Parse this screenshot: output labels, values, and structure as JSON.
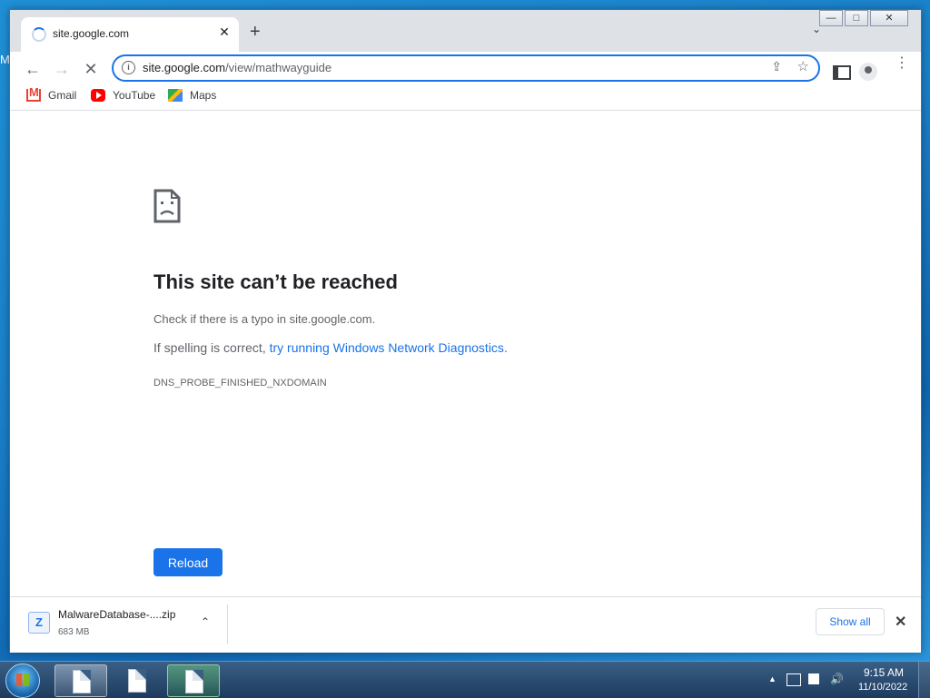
{
  "desktop": {
    "edge_char": "M"
  },
  "browser": {
    "tab": {
      "title": "site.google.com",
      "close_glyph": "✕"
    },
    "new_tab_glyph": "+",
    "tab_search_glyph": "⌄",
    "caption": {
      "minimize": "—",
      "maximize": "□",
      "close": "✕"
    },
    "nav": {
      "back": "←",
      "forward": "→",
      "stop": "✕"
    },
    "omnibox": {
      "host": "site.google.com",
      "path": "/view/mathwayguide",
      "info_glyph": "i",
      "share_glyph": "⇪",
      "star_glyph": "☆"
    },
    "menu_glyph": "⋮",
    "bookmarks": [
      {
        "label": "Gmail",
        "icon": "gmail-icon"
      },
      {
        "label": "YouTube",
        "icon": "youtube-icon"
      },
      {
        "label": "Maps",
        "icon": "maps-icon"
      }
    ]
  },
  "error_page": {
    "icon": "sad-document-icon",
    "title": "This site can’t be reached",
    "line1": "Check if there is a typo in site.google.com.",
    "line2_prefix": "If spelling is correct, ",
    "line2_link": "try running Windows Network Diagnostics",
    "line2_suffix": ".",
    "error_code": "DNS_PROBE_FINISHED_NXDOMAIN",
    "reload_label": "Reload"
  },
  "download_bar": {
    "file_name": "MalwareDatabase-....zip",
    "file_size": "683 MB",
    "chevron": "⌃",
    "show_all_label": "Show all",
    "close_glyph": "✕"
  },
  "taskbar": {
    "time": "9:15 AM",
    "date": "11/10/2022",
    "tray_arrow": "▲",
    "volume_glyph": "🔊"
  },
  "colors": {
    "accent": "#1a73e8",
    "title_text": "#202124",
    "secondary_text": "#5f6368"
  }
}
